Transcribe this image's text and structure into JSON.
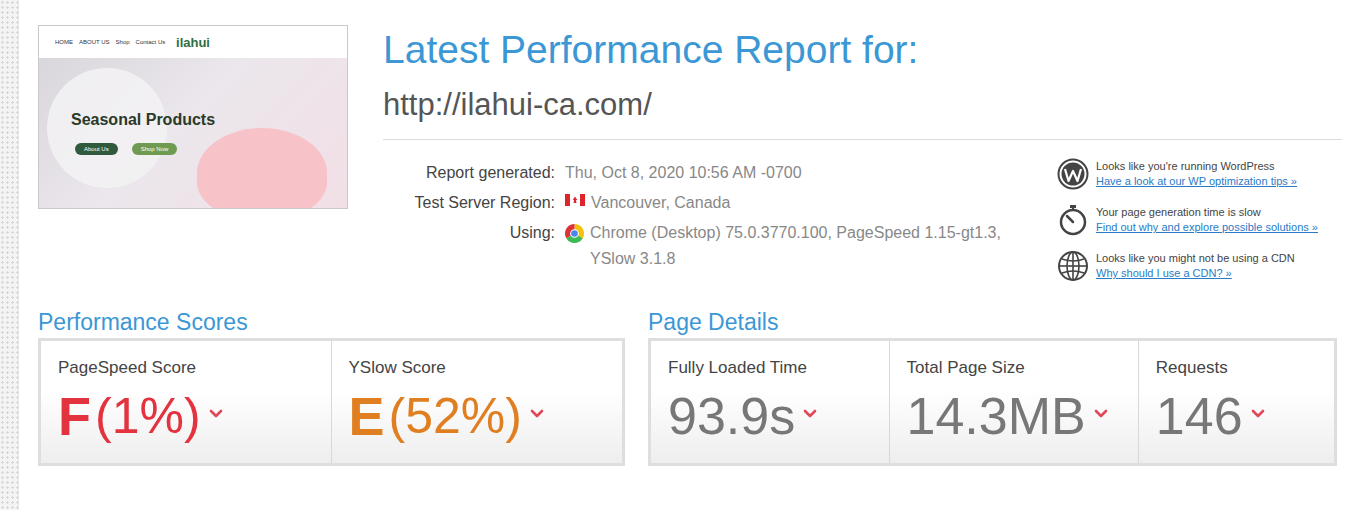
{
  "thumbnail": {
    "logo": "ilahui",
    "nav": [
      "HOME",
      "ABOUT US",
      "Shop",
      "Contact Us"
    ],
    "headline": "Seasonal Products",
    "buttons": [
      "About Us",
      "Shop Now"
    ]
  },
  "header": {
    "title": "Latest Performance Report for:",
    "url": "http://ilahui-ca.com/"
  },
  "details": [
    {
      "label": "Report generated:",
      "value": "Thu, Oct 8, 2020 10:56 AM -0700",
      "kind": "text"
    },
    {
      "label": "Test Server Region:",
      "value": "Vancouver, Canada",
      "kind": "flag"
    },
    {
      "label": "Using:",
      "value": "Chrome (Desktop) 75.0.3770.100, PageSpeed 1.15-gt1.3, YSlow 3.1.8",
      "kind": "browser"
    }
  ],
  "tips": [
    {
      "text": "Looks like you're running WordPress",
      "link": "Have a look at our WP optimization tips »",
      "kind": "wordpress"
    },
    {
      "text": "Your page generation time is slow",
      "link": "Find out why and explore possible solutions »",
      "kind": "timer"
    },
    {
      "text": "Looks like you might not be using a CDN",
      "link": "Why should I use a CDN? »",
      "kind": "globe"
    }
  ],
  "scores": {
    "title": "Performance Scores",
    "items": [
      {
        "label": "PageSpeed Score",
        "grade": "F",
        "percent": "(1%)",
        "color": "#e2333f"
      },
      {
        "label": "YSlow Score",
        "grade": "E",
        "percent": "(52%)",
        "color": "#e07f22"
      }
    ]
  },
  "page_details": {
    "title": "Page Details",
    "items": [
      {
        "label": "Fully Loaded Time",
        "value": "93.9s"
      },
      {
        "label": "Total Page Size",
        "value": "14.3MB"
      },
      {
        "label": "Requests",
        "value": "146"
      }
    ]
  }
}
